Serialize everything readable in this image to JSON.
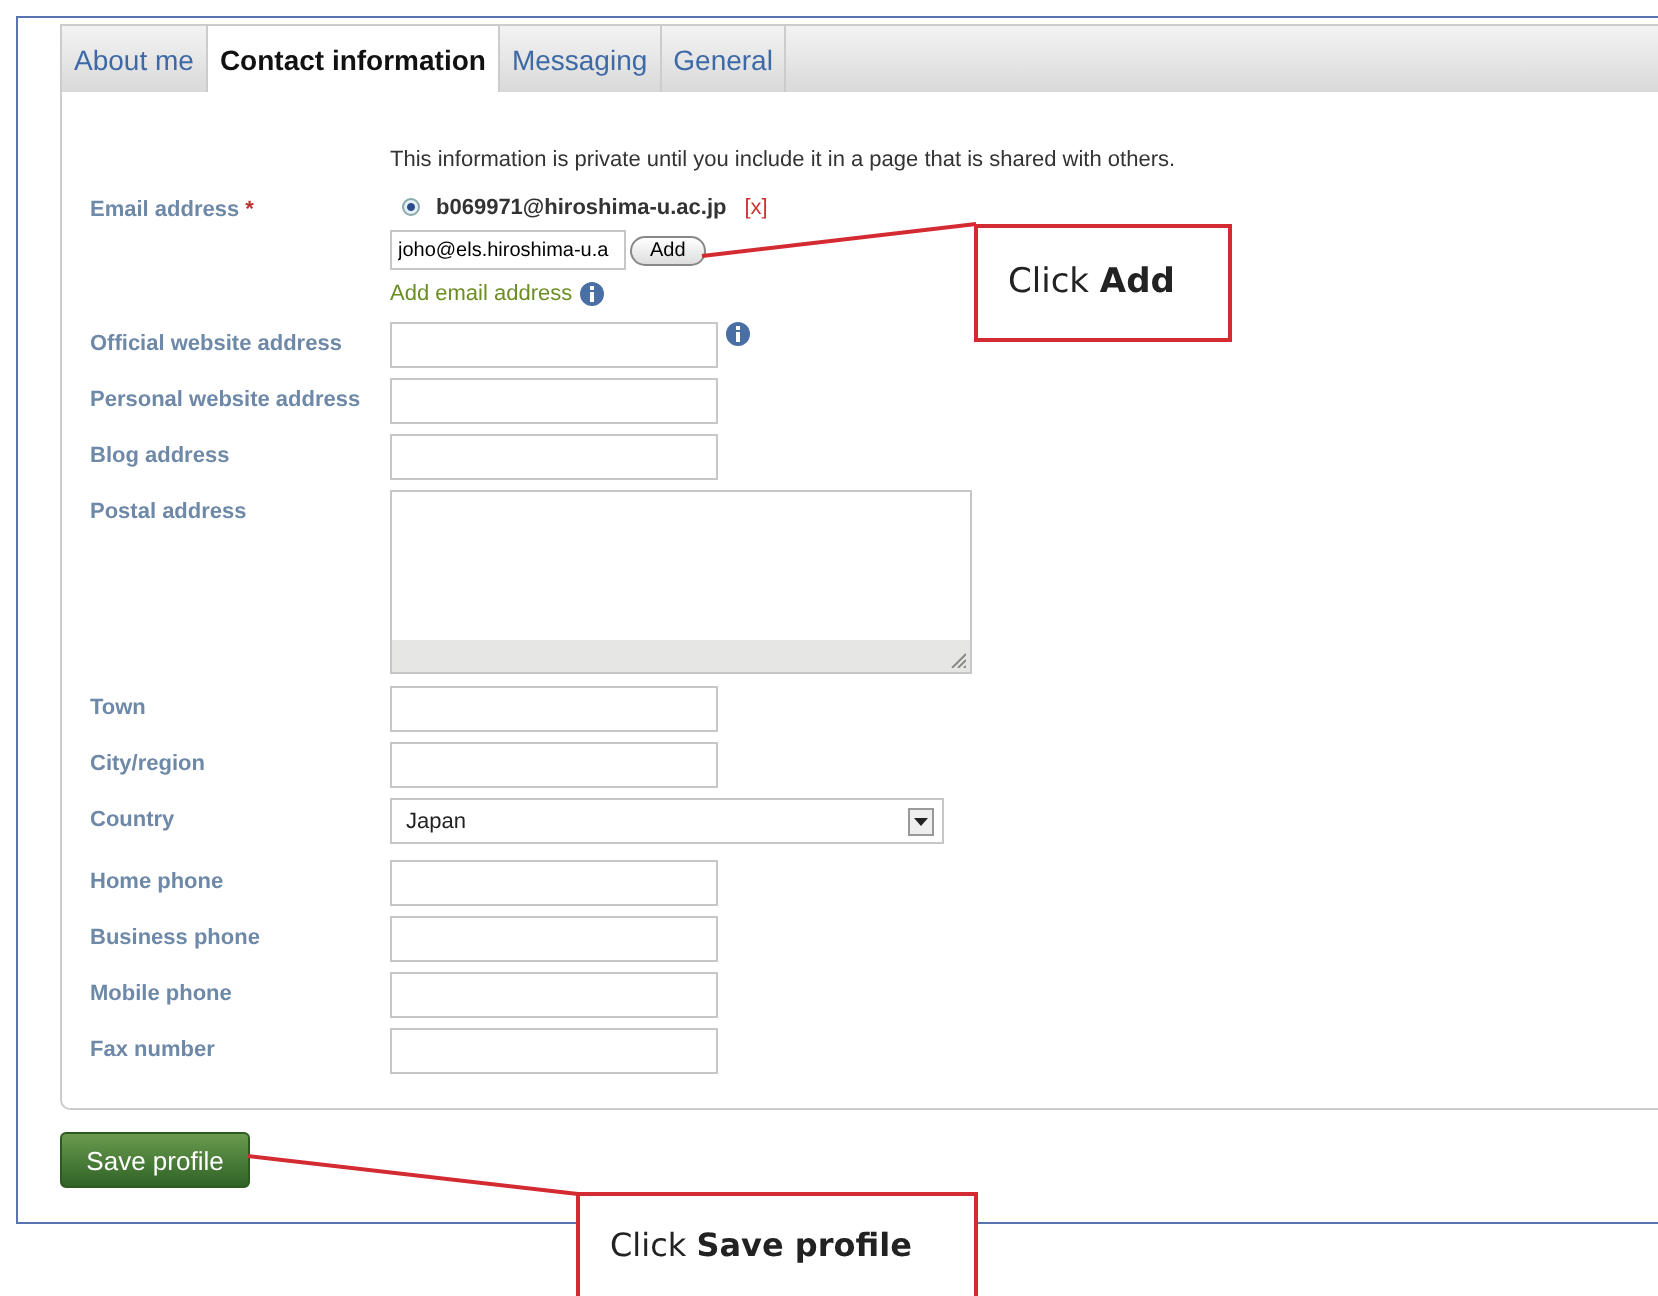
{
  "tabs": [
    {
      "label": "About me",
      "selected": false
    },
    {
      "label": "Contact information",
      "selected": true
    },
    {
      "label": "Messaging",
      "selected": false
    },
    {
      "label": "General",
      "selected": false
    }
  ],
  "privacy_note": "This information is private until you include it in a page that is shared with others.",
  "fields": [
    {
      "kind": "email",
      "label": "Email address",
      "required_mark": "*",
      "emails": [
        {
          "address": "b069971@hiroshima-u.ac.jp",
          "selected": true,
          "remove": "[x]"
        }
      ],
      "new_email": "joho@els.hiroshima-u.a",
      "add_button": "Add",
      "add_link": "Add email address",
      "info": true
    },
    {
      "kind": "text",
      "label": "Official website address",
      "info": true
    },
    {
      "kind": "text",
      "label": "Personal website address",
      "info": false
    },
    {
      "kind": "text",
      "label": "Blog address",
      "info": false
    },
    {
      "kind": "textarea",
      "label": "Postal address",
      "info": false
    },
    {
      "kind": "text",
      "label": "Town",
      "info": false
    },
    {
      "kind": "text",
      "label": "City/region",
      "info": false
    },
    {
      "kind": "select",
      "label": "Country",
      "value": "Japan",
      "info": false
    },
    {
      "kind": "text",
      "label": "Home phone",
      "info": false
    },
    {
      "kind": "text",
      "label": "Business phone",
      "info": false
    },
    {
      "kind": "text",
      "label": "Mobile phone",
      "info": false
    },
    {
      "kind": "text",
      "label": "Fax number",
      "info": false
    }
  ],
  "save_button": "Save profile",
  "callouts": [
    {
      "text": "Click **Add**"
    },
    {
      "text": "Click **Save profile**"
    }
  ]
}
